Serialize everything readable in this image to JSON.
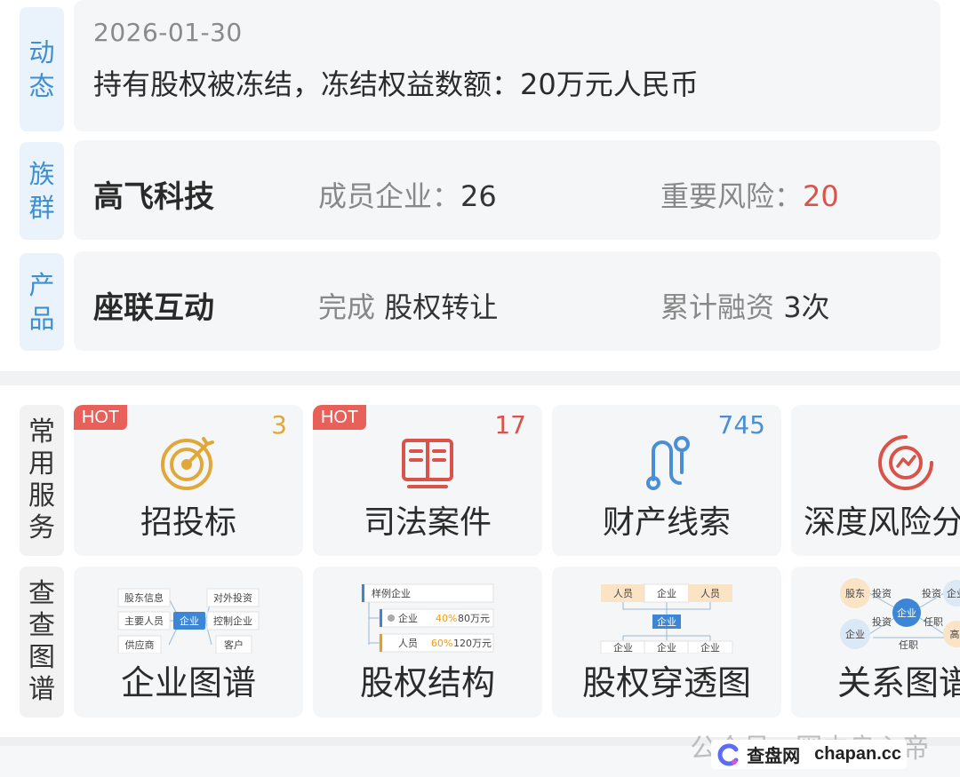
{
  "dynamics": {
    "tag": [
      "动",
      "态"
    ],
    "date": "2026-01-30",
    "text": "持有股权被冻结，冻结权益数额：20万元人民币"
  },
  "group": {
    "tag": [
      "族",
      "群"
    ],
    "name": "高飞科技",
    "members_label": "成员企业：",
    "members_value": "26",
    "risk_label": "重要风险：",
    "risk_value": "20"
  },
  "product": {
    "tag": [
      "产",
      "品"
    ],
    "name": "座联互动",
    "event_label": "完成 ",
    "event_value": "股权转让",
    "financing_label": "累计融资 ",
    "financing_value": "3次"
  },
  "services": {
    "tag": [
      "常",
      "用",
      "服",
      "务"
    ],
    "items": [
      {
        "label": "招投标",
        "count": "3",
        "hot": "HOT",
        "count_color": "#e0a83a",
        "icon": "target-icon"
      },
      {
        "label": "司法案件",
        "count": "17",
        "hot": "HOT",
        "count_color": "#d9534a",
        "icon": "book-icon"
      },
      {
        "label": "财产线索",
        "count": "745",
        "hot": "",
        "count_color": "#4a8fd6",
        "icon": "route-icon"
      },
      {
        "label": "深度风险分",
        "count": "",
        "hot": "",
        "count_color": "#d9534a",
        "icon": "radar-icon"
      }
    ]
  },
  "graphs": {
    "tag": [
      "查",
      "查",
      "图",
      "谱"
    ],
    "items": [
      {
        "label": "企业图谱",
        "nodes": [
          "股东信息",
          "对外投资",
          "主要人员",
          "企业",
          "控制企业",
          "供应商",
          "客户"
        ]
      },
      {
        "label": "股权结构",
        "nodes": [
          "样例企业",
          "企业",
          "40%",
          "80万元",
          "人员",
          "60%",
          "120万元"
        ]
      },
      {
        "label": "股权穿透图",
        "nodes": [
          "人员",
          "企业",
          "人员",
          "企业",
          "企业",
          "企业",
          "企业"
        ]
      },
      {
        "label": "关系图谱",
        "nodes": [
          "股东",
          "投资",
          "企业",
          "投资",
          "企业",
          "投资",
          "任职",
          "企业",
          "任职",
          "高"
        ]
      }
    ]
  },
  "watermark": "公众号 · 圈内良心帝",
  "brand": {
    "name": "查盘网",
    "domain": "chapan.cc"
  }
}
